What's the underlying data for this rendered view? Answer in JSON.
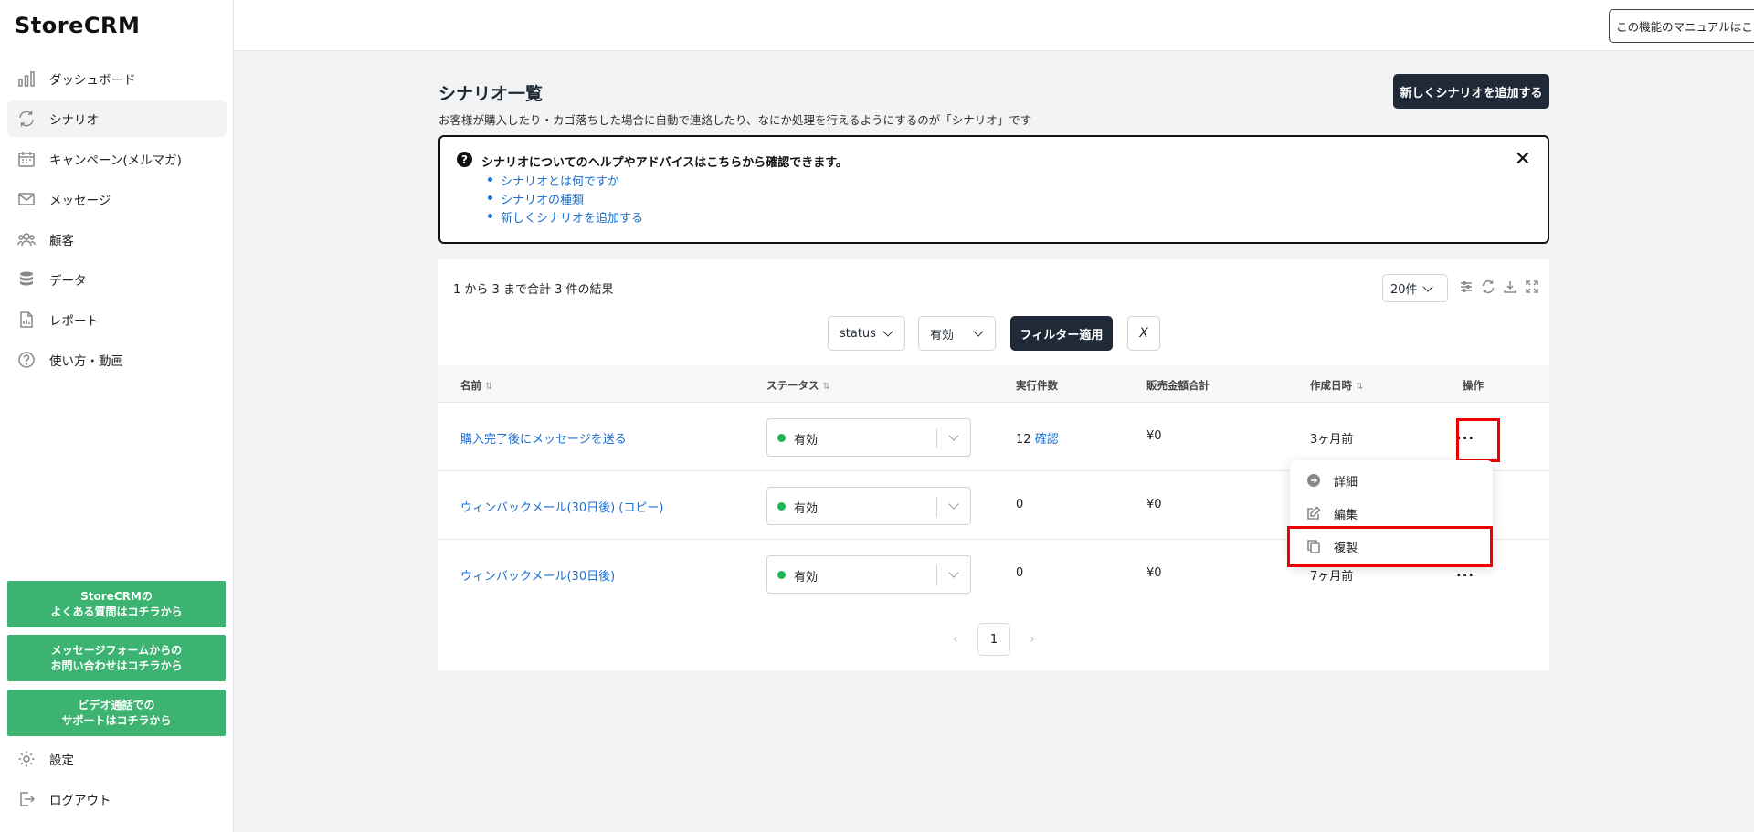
{
  "app": {
    "logo": "StoreCRM"
  },
  "sidebar": {
    "items": [
      {
        "label": "ダッシュボード",
        "icon": "bar-chart-icon"
      },
      {
        "label": "シナリオ",
        "icon": "refresh-icon",
        "active": true
      },
      {
        "label": "キャンペーン(メルマガ)",
        "icon": "calendar-icon"
      },
      {
        "label": "メッセージ",
        "icon": "mail-icon"
      },
      {
        "label": "顧客",
        "icon": "users-icon"
      },
      {
        "label": "データ",
        "icon": "database-icon"
      },
      {
        "label": "レポート",
        "icon": "report-icon"
      },
      {
        "label": "使い方・動画",
        "icon": "help-circle-icon"
      }
    ],
    "support_buttons": [
      "StoreCRMの\nよくある質問はコチラから",
      "メッセージフォームからの\nお問い合わせはコチラから",
      "ビデオ通話での\nサポートはコチラから"
    ],
    "bottom_items": [
      {
        "label": "設定",
        "icon": "gear-icon"
      },
      {
        "label": "ログアウト",
        "icon": "logout-icon"
      }
    ],
    "support_color": "#3cb371"
  },
  "topbar": {
    "manual_button": "この機能のマニュアルはこちら"
  },
  "page": {
    "title": "シナリオ一覧",
    "subtitle": "お客様が購入したり・カゴ落ちした場合に自動で連絡したり、なにか処理を行えるようにするのが「シナリオ」です",
    "add_button": "新しくシナリオを追加する"
  },
  "help": {
    "title": "シナリオについてのヘルプやアドバイスはこちらから確認できます。",
    "links": [
      "シナリオとは何ですか",
      "シナリオの種類",
      "新しくシナリオを追加する"
    ],
    "close": "✕"
  },
  "table_toolbar": {
    "result_text": "1 から 3 まで合計 3 件の結果",
    "page_size": "20件",
    "filter_field": "status",
    "filter_value": "有効",
    "apply_button": "フィルター適用",
    "clear_button": "X"
  },
  "table": {
    "columns": [
      "名前",
      "ステータス",
      "実行件数",
      "販売金額合計",
      "作成日時",
      "操作"
    ],
    "rows": [
      {
        "name": "購入完了後にメッセージを送る",
        "status": "有効",
        "count": "12",
        "count_link": "確認",
        "sales": "¥0",
        "created": "3ヶ月前",
        "action": "..."
      },
      {
        "name": "ウィンバックメール(30日後) (コピー)",
        "status": "有効",
        "count": "0",
        "count_link": "",
        "sales": "¥0",
        "created": "",
        "action": ""
      },
      {
        "name": "ウィンバックメール(30日後)",
        "status": "有効",
        "count": "0",
        "count_link": "",
        "sales": "¥0",
        "created": "7ヶ月前",
        "action": "..."
      }
    ]
  },
  "pagination": {
    "prev": "‹",
    "current": "1",
    "next": "›"
  },
  "dropdown": {
    "items": [
      {
        "label": "詳細",
        "icon": "arrow-circle-icon"
      },
      {
        "label": "編集",
        "icon": "edit-icon"
      },
      {
        "label": "複製",
        "icon": "copy-icon"
      }
    ]
  },
  "colors": {
    "status_active": "#22b454",
    "link": "#1a6fd1",
    "primary_dark": "#1f2937",
    "highlight": "#ee0000"
  }
}
